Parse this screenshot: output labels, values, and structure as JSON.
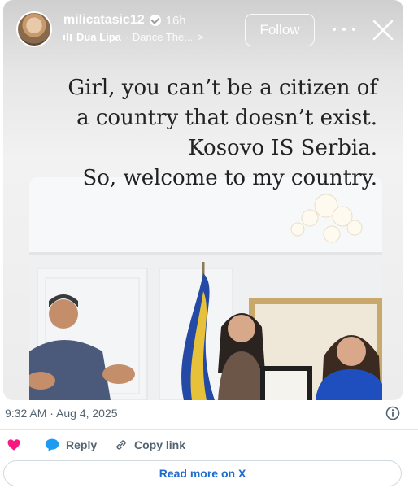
{
  "story": {
    "username": "milicatasic12",
    "time_ago": "16h",
    "music": {
      "artist": "Dua Lipa",
      "track": "· Dance The...",
      "chevron": ">"
    },
    "follow_label": "Follow",
    "caption_lines": [
      "Girl, you can’t be a citizen of",
      "a country that doesn’t exist.",
      "Kosovo IS Serbia.",
      "So, welcome to my country."
    ],
    "icons": {
      "verified": "verified-badge-icon",
      "music": "music-bars-icon",
      "more": "more-dots-icon",
      "close": "close-icon"
    }
  },
  "tweet": {
    "timestamp": "9:32 AM · Aug 4, 2025",
    "actions": {
      "reply_label": "Reply",
      "copy_label": "Copy link"
    },
    "read_more_label": "Read more on X"
  },
  "colors": {
    "heart": "#f91880",
    "reply": "#1d9bf0",
    "link": "#1d6ccf",
    "muted": "#536471"
  }
}
